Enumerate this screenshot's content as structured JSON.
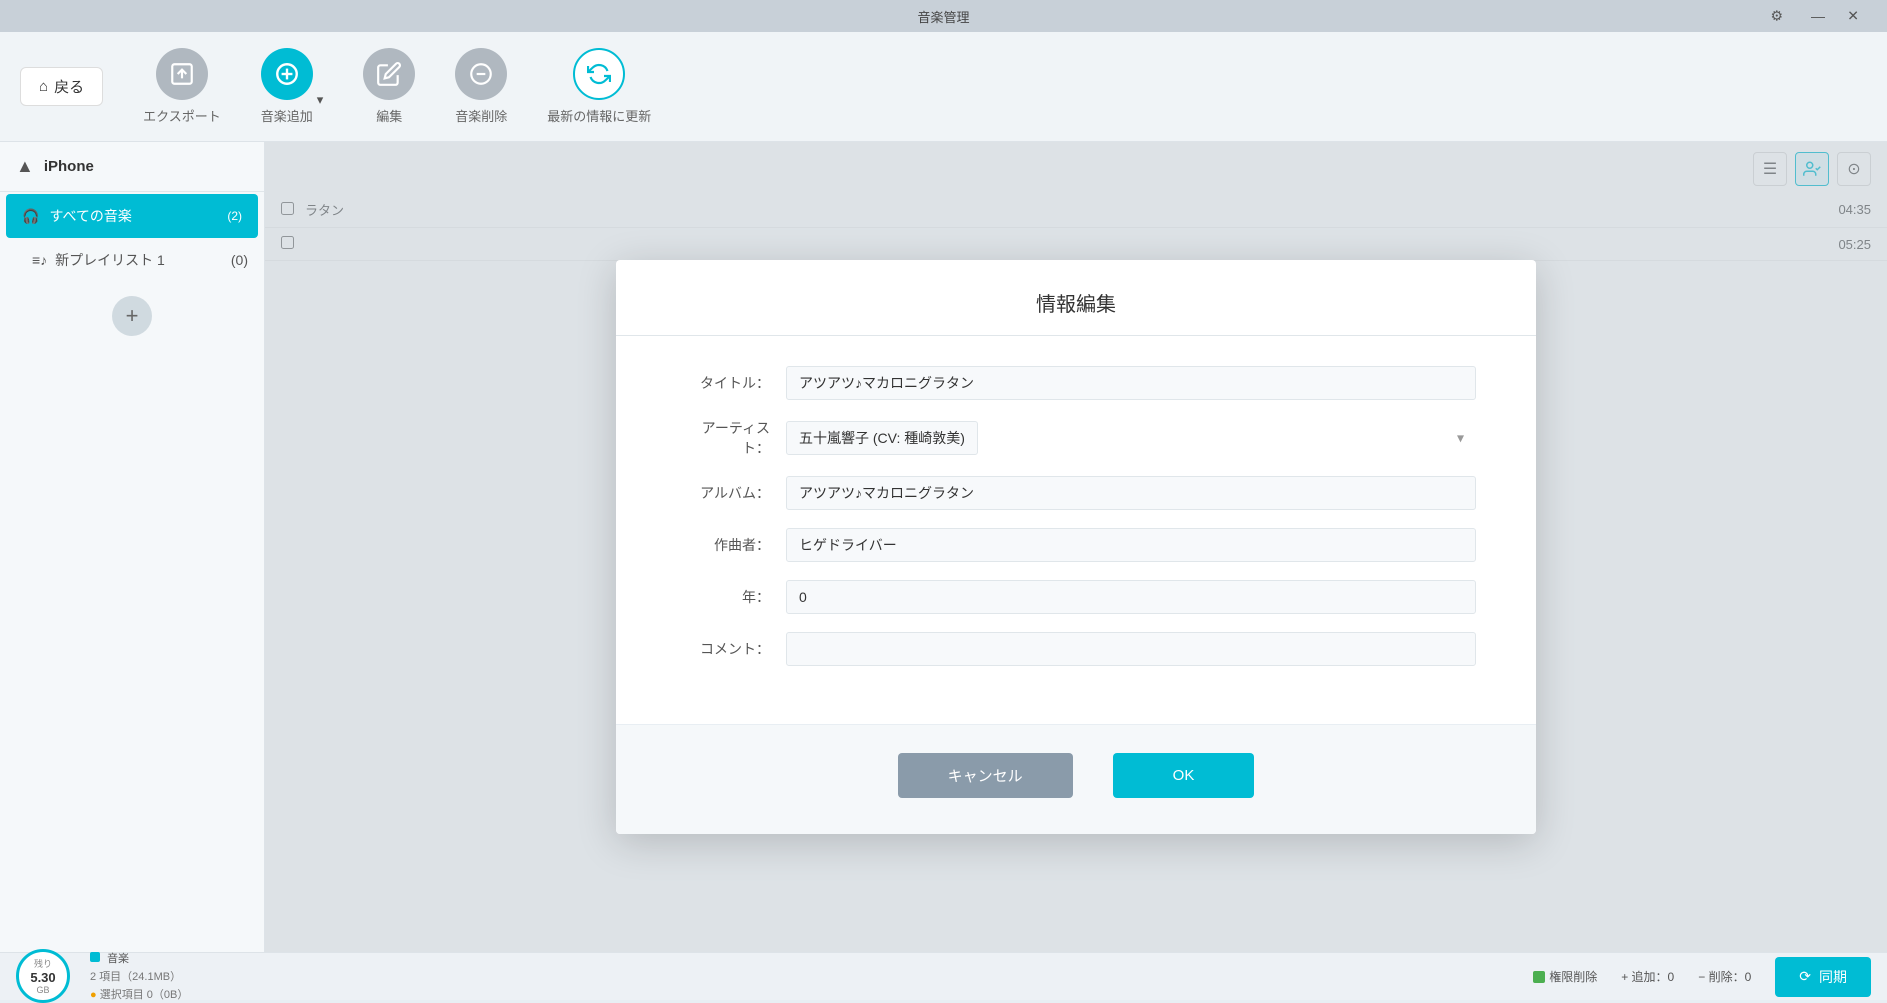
{
  "titlebar": {
    "title": "音楽管理",
    "gear_icon": "⚙",
    "minimize_icon": "—",
    "close_icon": "✕"
  },
  "toolbar": {
    "back_label": "戻る",
    "back_icon": "⌂",
    "export_label": "エクスポート",
    "add_music_label": "音楽追加",
    "edit_label": "編集",
    "delete_music_label": "音楽削除",
    "update_label": "最新の情報に更新"
  },
  "sidebar": {
    "device_name": "iPhone",
    "all_music_label": "すべての音楽",
    "all_music_count": "(2)",
    "playlist_label": "新プレイリスト 1",
    "playlist_count": "(0)",
    "add_btn": "+"
  },
  "content": {
    "rows": [
      {
        "duration": "04:35"
      },
      {
        "duration": "05:25"
      }
    ],
    "partial_text": "ラタン"
  },
  "dialog": {
    "title": "情報編集",
    "title_label": "タイトル：",
    "title_value": "アツアツ♪マカロニグラタン",
    "artist_label": "アーティスト：",
    "artist_value": "五十嵐響子 (CV: 種崎敦美)",
    "album_label": "アルバム：",
    "album_value": "アツアツ♪マカロニグラタン",
    "composer_label": "作曲者：",
    "composer_value": "ヒゲドライバー",
    "year_label": "年：",
    "year_value": "0",
    "comment_label": "コメント：",
    "comment_value": "",
    "cancel_label": "キャンセル",
    "ok_label": "OK"
  },
  "statusbar": {
    "remaining_label": "残り",
    "storage_gb": "5.30",
    "storage_unit": "GB",
    "music_label": "音楽",
    "items_label": "2 項目（24.1MB）",
    "selected_label": "選択項目 0（0B）",
    "permission_label": "権限削除",
    "add_label": "+ 追加：0",
    "delete_label": "− 削除：0",
    "sync_label": "同期",
    "sync_icon": "⟳"
  }
}
